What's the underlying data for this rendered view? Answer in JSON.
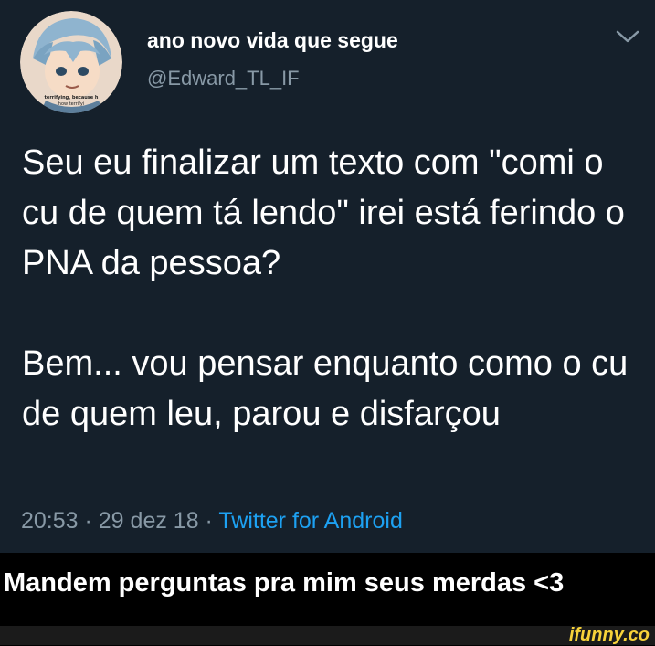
{
  "tweet": {
    "display_name": "ano novo vida que segue",
    "handle": "@Edward_TL_IF",
    "avatar_caption": "terrifying, because how terrifying",
    "body": [
      "Seu eu finalizar um texto com \"comi o cu de quem tá lendo\" irei está ferindo o PNA da pessoa?",
      "Bem... vou pensar enquanto como o cu de quem leu, parou e disfarçou"
    ],
    "time": "20:53",
    "separator": " · ",
    "date": "29 dez 18",
    "source": "Twitter for Android",
    "menu_icon": "chevron-down-icon"
  },
  "caption": "Mandem perguntas pra mim seus merdas  <3",
  "watermark": "ifunny.co",
  "colors": {
    "background": "#15202b",
    "text": "#ffffff",
    "muted": "#8899a6",
    "link": "#1da1f2",
    "watermark": "#f7d23a"
  }
}
